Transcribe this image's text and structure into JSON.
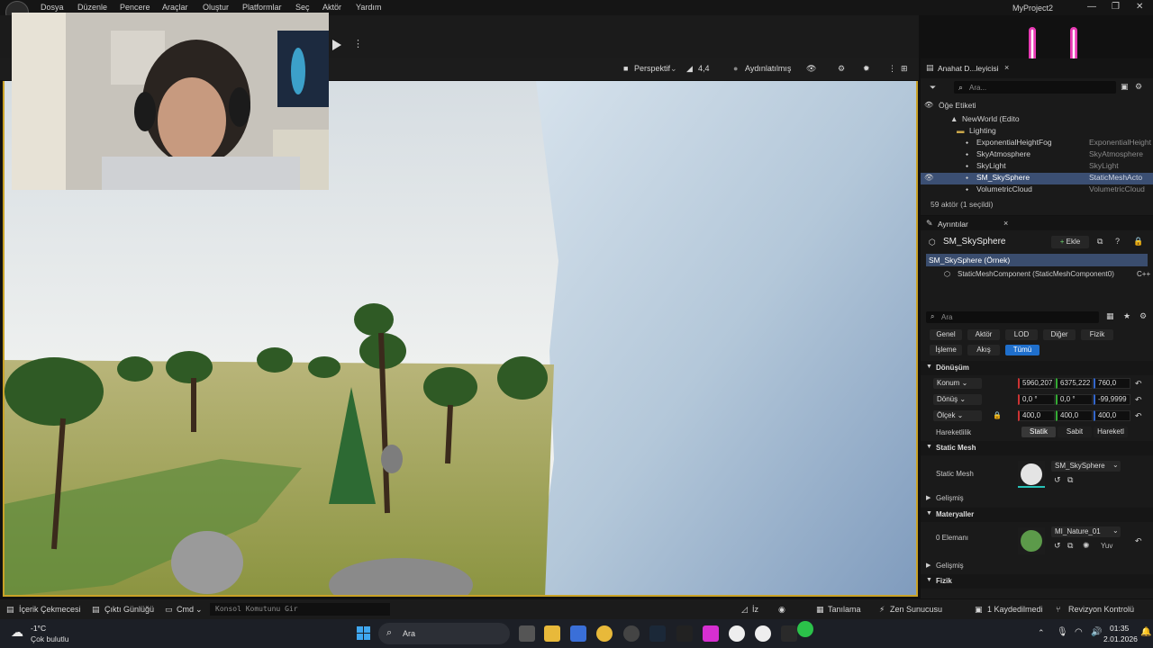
{
  "menu": [
    "Dosya",
    "Düzenle",
    "Pencere",
    "Araçlar",
    "Oluştur",
    "Platformlar",
    "Seç",
    "Aktör",
    "Yardım"
  ],
  "project_name": "MyProject2",
  "viewport_bar": {
    "perspective": "Perspektif",
    "fov": "4,4",
    "lit": "Aydınlatılmış"
  },
  "outliner": {
    "tab_title": "Anahat D...leyicisi",
    "search_placeholder": "Ara...",
    "column_label": "Öğe Etiketi",
    "items": [
      {
        "label": "NewWorld (Edito",
        "type": ""
      },
      {
        "label": "Lighting",
        "type": ""
      },
      {
        "label": "ExponentialHeightFog",
        "type": "ExponentialHeight"
      },
      {
        "label": "SkyAtmosphere",
        "type": "SkyAtmosphere"
      },
      {
        "label": "SkyLight",
        "type": "SkyLight"
      },
      {
        "label": "SM_SkySphere",
        "type": "StaticMeshActo"
      },
      {
        "label": "VolumetricCloud",
        "type": "VolumetricCloud"
      }
    ],
    "footer": "59 aktör (1 seçildi)"
  },
  "details": {
    "tab_title": "Ayrıntılar",
    "actor_name": "SM_SkySphere",
    "add_label": "Ekle",
    "instance_label": "SM_SkySphere (Örnek)",
    "component_label": "StaticMeshComponent (StaticMeshComponent0)",
    "cpp_label": "C++",
    "search_placeholder": "Ara",
    "filters_row1": [
      "Genel",
      "Aktör",
      "LOD",
      "Diğer",
      "Fizik"
    ],
    "filters_row2": [
      "İşleme",
      "Akış",
      "Tümü"
    ],
    "transform_header": "Dönüşüm",
    "location_label": "Konum",
    "rotation_label": "Dönüş",
    "scale_label": "Ölçek",
    "location": [
      "5960,207",
      "6375,222",
      "760,0"
    ],
    "rotation": [
      "0,0 °",
      "0,0 °",
      "-99,9999"
    ],
    "scale": [
      "400,0",
      "400,0",
      "400,0"
    ],
    "mobility_label": "Hareketlilik",
    "mobility_options": [
      "Statik",
      "Sabit",
      "Hareketl"
    ],
    "static_mesh_header": "Static Mesh",
    "static_mesh_label": "Static Mesh",
    "static_mesh_value": "SM_SkySphere",
    "advanced_label": "Gelişmiş",
    "materials_header": "Materyaller",
    "element_label": "0 Elemanı",
    "material_value": "MI_Nature_01",
    "yuv_label": "Yuv",
    "advanced_label_2": "Gelişmiş",
    "physics_header": "Fizik"
  },
  "statusbar": {
    "content_drawer": "İçerik Çekmecesi",
    "output_log": "Çıktı Günlüğü",
    "cmd": "Cmd",
    "console_placeholder": "Konsol Komutunu Gir",
    "iz": "İz",
    "tanilama": "Tanılama",
    "zen": "Zen Sunucusu",
    "unsaved": "1 Kaydedilmedi",
    "revision": "Revizyon Kontrolü"
  },
  "taskbar": {
    "weather_temp": "-1°C",
    "weather_desc": "Çok bulutlu",
    "search": "Ara",
    "time": "01:35",
    "date": "2.01.2026"
  }
}
